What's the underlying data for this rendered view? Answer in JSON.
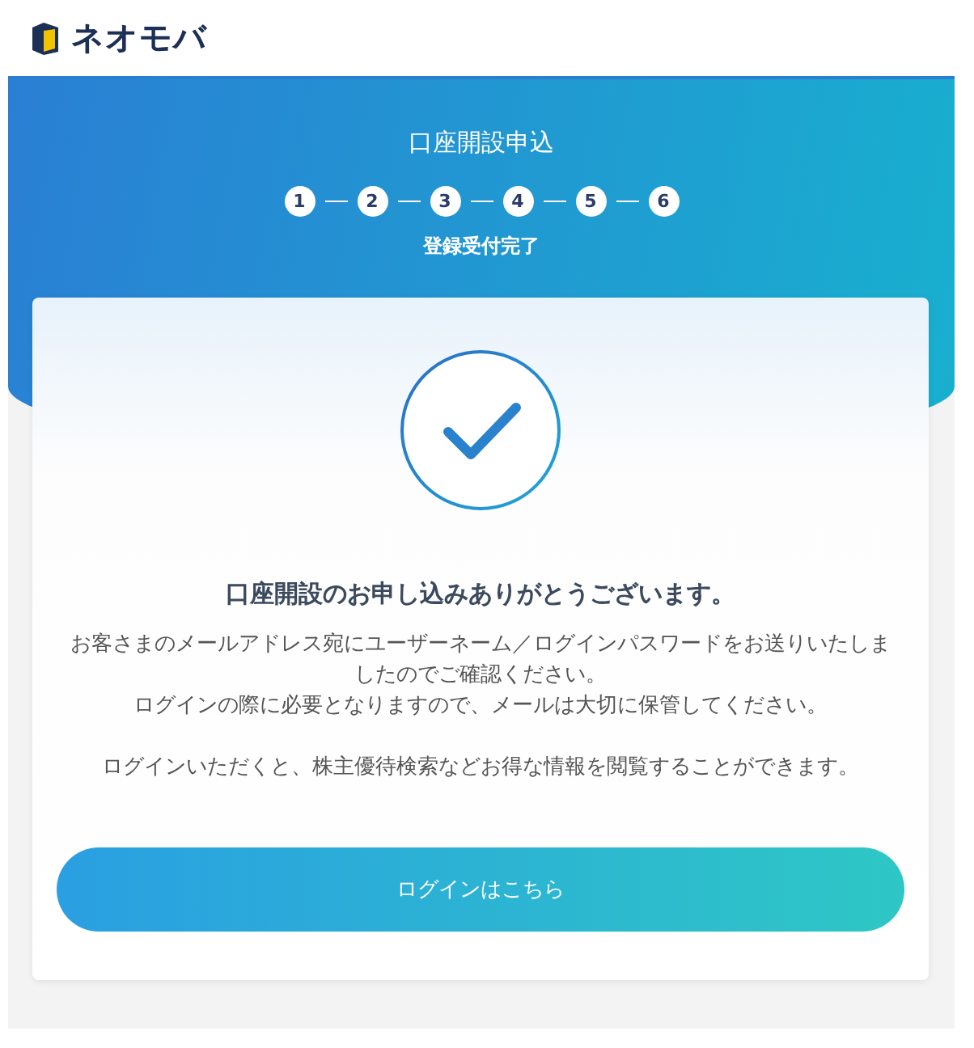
{
  "header": {
    "logo_text": "ネオモバ"
  },
  "hero": {
    "title": "口座開設申込",
    "steps": [
      "1",
      "2",
      "3",
      "4",
      "5",
      "6"
    ],
    "step_label": "登録受付完了"
  },
  "card": {
    "heading": "口座開設のお申し込みありがとうございます。",
    "paragraphs": [
      "お客さまのメールアドレス宛にユーザーネーム／ログインパスワードをお送りいたしましたのでご確認ください。",
      "ログインの際に必要となりますので、メールは大切に保管してください。",
      "ログインいただくと、株主優待検索などお得な情報を閲覧することができます。"
    ],
    "button": "ログインはこちら"
  }
}
